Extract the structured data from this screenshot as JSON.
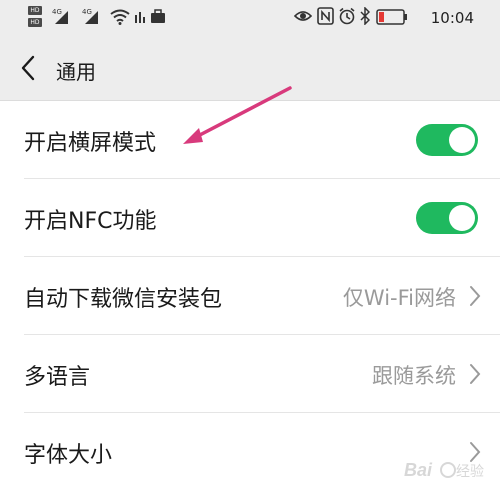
{
  "status_bar": {
    "hd_badges": [
      "HD",
      "HD"
    ],
    "signal_tags": [
      "4G",
      "4G"
    ],
    "time": "10:04",
    "icons": [
      "eye-icon",
      "nfc-icon",
      "alarm-icon",
      "bluetooth-icon",
      "battery-low-icon",
      "wifi-icon",
      "data-icon",
      "briefcase-icon"
    ],
    "battery_color": "#e53935"
  },
  "header": {
    "title": "通用",
    "back_icon": "chevron-left-icon"
  },
  "settings": [
    {
      "label": "开启横屏模式",
      "type": "toggle",
      "on": true
    },
    {
      "label": "开启NFC功能",
      "type": "toggle",
      "on": true
    },
    {
      "label": "自动下载微信安装包",
      "type": "value",
      "value": "仅Wi-Fi网络"
    },
    {
      "label": "多语言",
      "type": "value",
      "value": "跟随系统"
    },
    {
      "label": "字体大小",
      "type": "value",
      "value": ""
    }
  ],
  "colors": {
    "toggle_on": "#1fb95f",
    "header_bg": "#ededed",
    "annotation_arrow": "#d83a7c"
  },
  "watermark": "Baidu 经验"
}
